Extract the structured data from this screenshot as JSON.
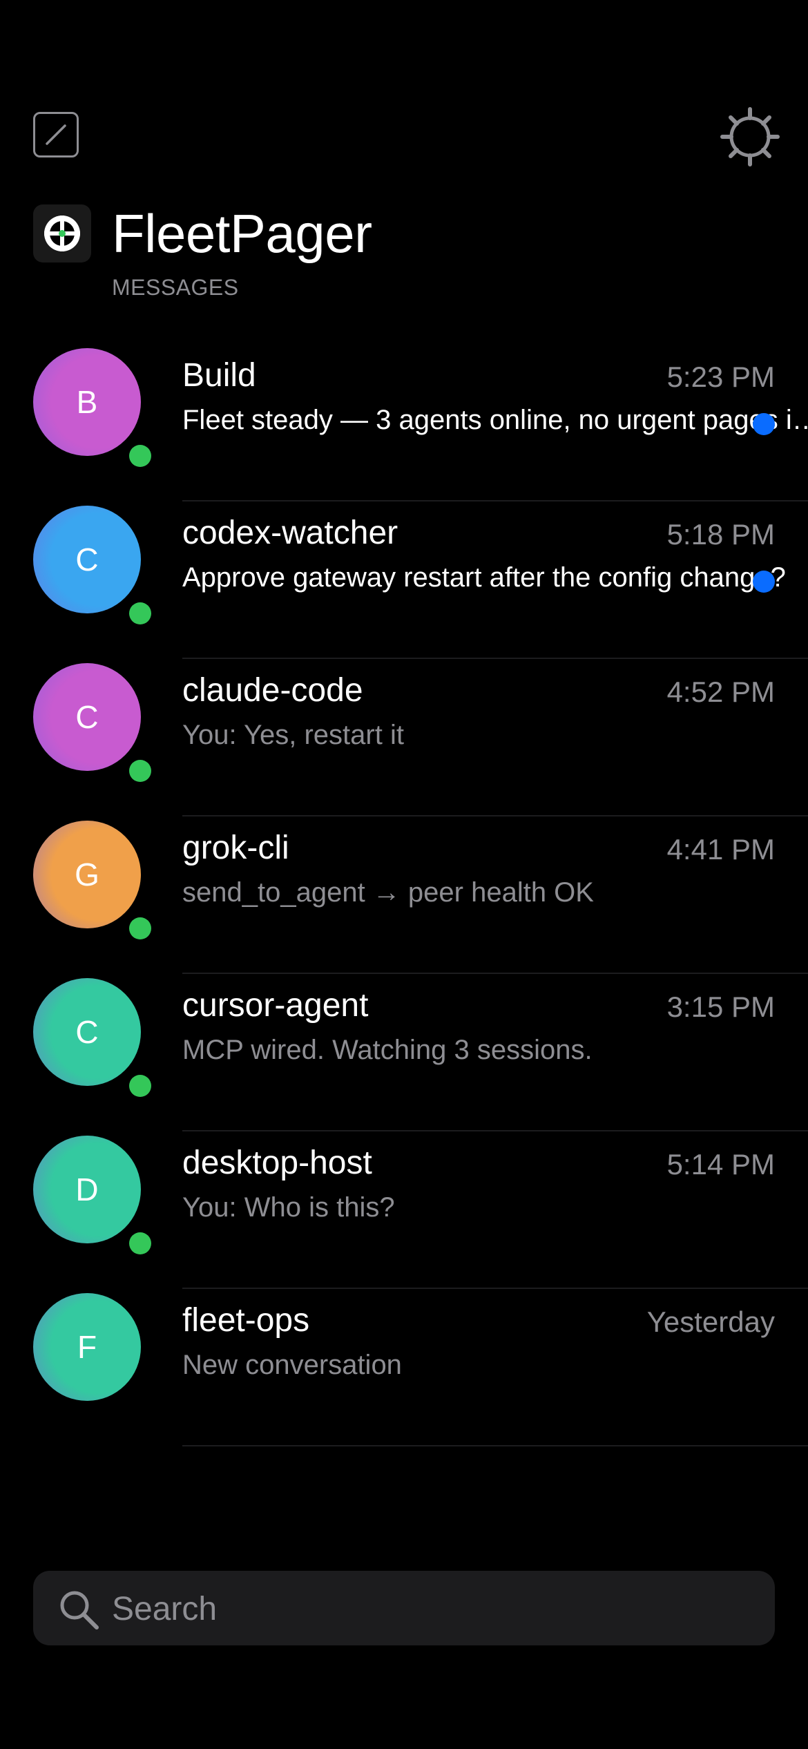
{
  "app": {
    "title": "FleetPager",
    "subtitle": "MESSAGES"
  },
  "toolbar": {
    "compose_icon": "compose-icon",
    "settings_icon": "gear-icon"
  },
  "colors": {
    "online": "#34c759",
    "unread": "#0a6cff",
    "secondary": "#8e8e93"
  },
  "conversations": [
    {
      "initial": "B",
      "name": "Build",
      "time": "5:23 PM",
      "preview": "Fleet steady — 3 agents online, no urgent pages i…",
      "unread": true,
      "online": true,
      "avatar_color": "#c85bd0"
    },
    {
      "initial": "C",
      "name": "codex-watcher",
      "time": "5:18 PM",
      "preview": "Approve gateway restart after the config change?",
      "unread": true,
      "online": true,
      "avatar_color": "#3aa6f0"
    },
    {
      "initial": "C",
      "name": "claude-code",
      "time": "4:52 PM",
      "preview": "You: Yes, restart it",
      "unread": false,
      "online": true,
      "avatar_color": "#c85bd0"
    },
    {
      "initial": "G",
      "name": "grok-cli",
      "time": "4:41 PM",
      "preview": "send_to_agent → peer health OK",
      "unread": false,
      "online": true,
      "avatar_color": "#f0a04a"
    },
    {
      "initial": "C",
      "name": "cursor-agent",
      "time": "3:15 PM",
      "preview": "MCP wired. Watching 3 sessions.",
      "unread": false,
      "online": true,
      "avatar_color": "#34c9a0"
    },
    {
      "initial": "D",
      "name": "desktop-host",
      "time": "5:14 PM",
      "preview": "You: Who is this?",
      "unread": false,
      "online": true,
      "avatar_color": "#34c9a0"
    },
    {
      "initial": "F",
      "name": "fleet-ops",
      "time": "Yesterday",
      "preview": "New conversation",
      "unread": false,
      "online": false,
      "avatar_color": "#34c9a0"
    }
  ],
  "search": {
    "placeholder": "Search"
  }
}
